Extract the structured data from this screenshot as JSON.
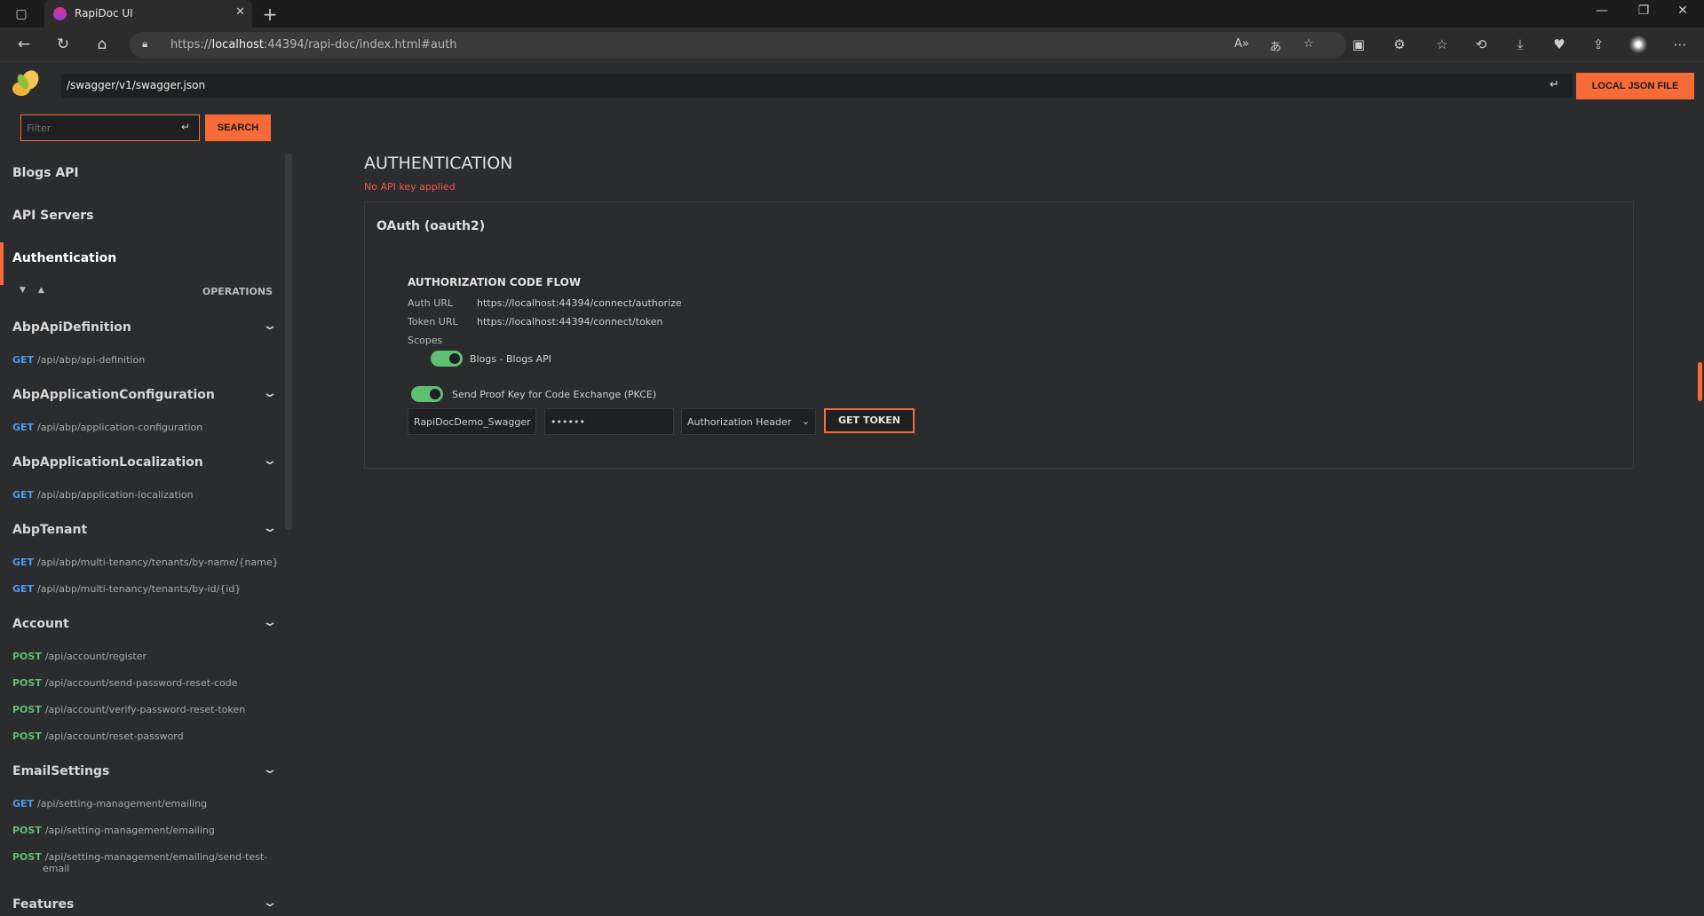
{
  "browser": {
    "tab_title": "RapiDoc UI",
    "url_host": "localhost",
    "url_prefix": "https://",
    "url_suffix": ":44394/rapi-doc/index.html#auth"
  },
  "header": {
    "spec_url": "/swagger/v1/swagger.json",
    "local_json_label": "LOCAL JSON FILE"
  },
  "sidebar": {
    "filter_placeholder": "Filter",
    "search_label": "SEARCH",
    "nav": [
      {
        "label": "Blogs API"
      },
      {
        "label": "API Servers"
      },
      {
        "label": "Authentication"
      }
    ],
    "operations_label": "OPERATIONS",
    "groups": [
      {
        "name": "AbpApiDefinition",
        "ops": [
          {
            "method": "GET",
            "path": "/api/abp/api-definition"
          }
        ]
      },
      {
        "name": "AbpApplicationConfiguration",
        "ops": [
          {
            "method": "GET",
            "path": "/api/abp/application-configuration"
          }
        ]
      },
      {
        "name": "AbpApplicationLocalization",
        "ops": [
          {
            "method": "GET",
            "path": "/api/abp/application-localization"
          }
        ]
      },
      {
        "name": "AbpTenant",
        "ops": [
          {
            "method": "GET",
            "path": "/api/abp/multi-tenancy/tenants/by-name/{name}"
          },
          {
            "method": "GET",
            "path": "/api/abp/multi-tenancy/tenants/by-id/{id}"
          }
        ]
      },
      {
        "name": "Account",
        "ops": [
          {
            "method": "POST",
            "path": "/api/account/register"
          },
          {
            "method": "POST",
            "path": "/api/account/send-password-reset-code"
          },
          {
            "method": "POST",
            "path": "/api/account/verify-password-reset-token"
          },
          {
            "method": "POST",
            "path": "/api/account/reset-password"
          }
        ]
      },
      {
        "name": "EmailSettings",
        "ops": [
          {
            "method": "GET",
            "path": "/api/setting-management/emailing"
          },
          {
            "method": "POST",
            "path": "/api/setting-management/emailing"
          },
          {
            "method": "POST",
            "path": "/api/setting-management/emailing/send-test-",
            "path2": "email"
          }
        ]
      },
      {
        "name": "Features",
        "ops": []
      }
    ]
  },
  "main": {
    "title": "AUTHENTICATION",
    "status": "No API key applied",
    "scheme": "OAuth (oauth2)",
    "flow_title": "AUTHORIZATION CODE FLOW",
    "auth_url_label": "Auth URL",
    "auth_url": "https://localhost:44394/connect/authorize",
    "token_url_label": "Token URL",
    "token_url": "https://localhost:44394/connect/token",
    "scopes_label": "Scopes",
    "scope": "Blogs - Blogs API",
    "pkce_label": "Send Proof Key for Code Exchange (PKCE)",
    "client_id": "RapiDocDemo_Swagger",
    "client_secret": "••••••",
    "send_in": "Authorization Header",
    "get_token_label": "GET TOKEN"
  }
}
